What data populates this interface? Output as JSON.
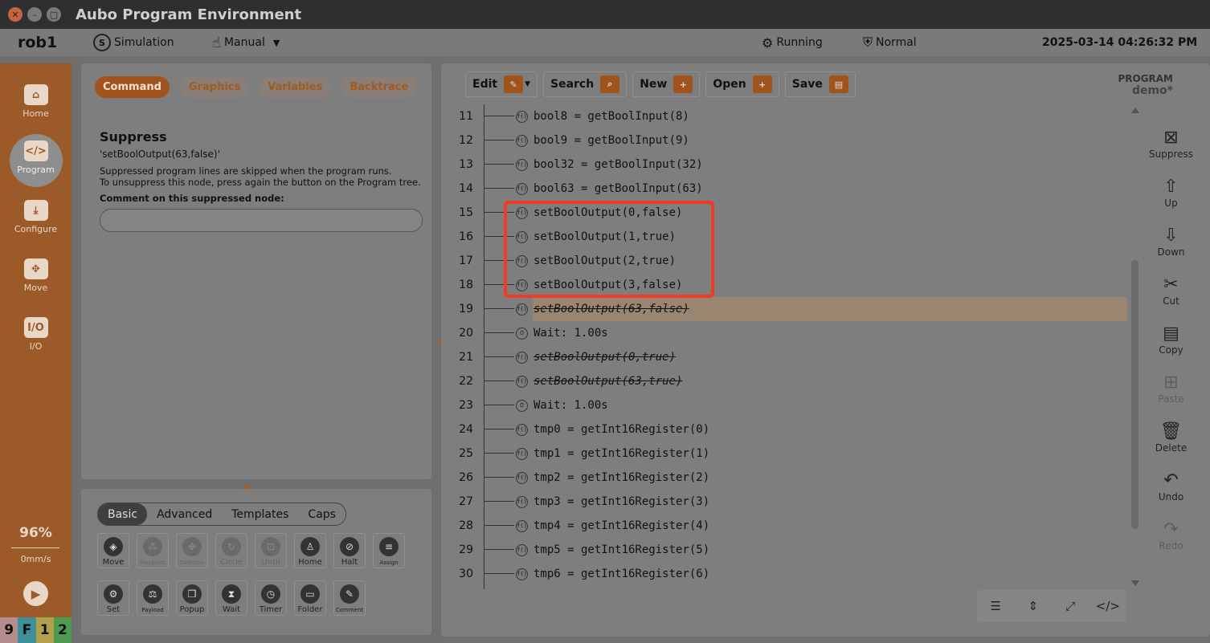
{
  "window": {
    "title": "Aubo Program Environment"
  },
  "header": {
    "robot": "rob1",
    "mode": "Simulation",
    "control": "Manual",
    "state": "Running",
    "safety": "Normal",
    "datetime": "2025-03-14 04:26:32 PM"
  },
  "nav": {
    "items": [
      {
        "label": "Home",
        "icon": "home-icon"
      },
      {
        "label": "Program",
        "icon": "code-icon"
      },
      {
        "label": "Configure",
        "icon": "download-icon"
      },
      {
        "label": "Move",
        "icon": "move-icon"
      },
      {
        "label": "I/O",
        "icon": "io-icon"
      }
    ],
    "speed_percent": "96%",
    "speed_value": "0mm/s",
    "fkeys": [
      {
        "label": "9",
        "color": "#b48c8c"
      },
      {
        "label": "F",
        "color": "#3f8f9a"
      },
      {
        "label": "1",
        "color": "#b2a04a"
      },
      {
        "label": "2",
        "color": "#4e9a4e"
      }
    ]
  },
  "left_tabs": [
    "Command",
    "Graphics",
    "Variables",
    "Backtrace"
  ],
  "suppress": {
    "title": "Suppress",
    "node": "'setBoolOutput(63,false)'",
    "desc1": "Suppressed program lines are skipped when the program runs.",
    "desc2": "To unsuppress this node, press again the button on the Program tree.",
    "comment_label": "Comment on this suppressed node:",
    "comment_value": ""
  },
  "palette": {
    "tabs": [
      "Basic",
      "Advanced",
      "Templates",
      "Caps"
    ],
    "buttons_row1": [
      "Move",
      "Waypoint",
      "Direction",
      "Circle",
      "Until",
      "Home",
      "Halt",
      "Assign"
    ],
    "buttons_row2": [
      "Set",
      "Payload",
      "Popup",
      "Wait",
      "Timer",
      "Folder",
      "Comment"
    ]
  },
  "toolbar": {
    "edit": "Edit",
    "search": "Search",
    "new": "New",
    "open": "Open",
    "save": "Save"
  },
  "program": {
    "label": "PROGRAM",
    "name": "demo*"
  },
  "code_lines": [
    {
      "n": "11",
      "text": "bool8 = getBoolInput(8)",
      "icon": "fn"
    },
    {
      "n": "12",
      "text": "bool9 = getBoolInput(9)",
      "icon": "fn"
    },
    {
      "n": "13",
      "text": "bool32 = getBoolInput(32)",
      "icon": "fn"
    },
    {
      "n": "14",
      "text": "bool63 = getBoolInput(63)",
      "icon": "fn"
    },
    {
      "n": "15",
      "text": "setBoolOutput(0,false)",
      "icon": "fn"
    },
    {
      "n": "16",
      "text": "setBoolOutput(1,true)",
      "icon": "fn"
    },
    {
      "n": "17",
      "text": "setBoolOutput(2,true)",
      "icon": "fn"
    },
    {
      "n": "18",
      "text": "setBoolOutput(3,false)",
      "icon": "fn"
    },
    {
      "n": "19",
      "text": "setBoolOutput(63,false)",
      "icon": "fn",
      "suppressed": true,
      "selected": true
    },
    {
      "n": "20",
      "text": "Wait: 1.00s",
      "icon": "wait"
    },
    {
      "n": "21",
      "text": "setBoolOutput(0,true)",
      "icon": "fn",
      "suppressed": true
    },
    {
      "n": "22",
      "text": "setBoolOutput(63,true)",
      "icon": "fn",
      "suppressed": true
    },
    {
      "n": "23",
      "text": "Wait: 1.00s",
      "icon": "wait"
    },
    {
      "n": "24",
      "text": "tmp0 = getInt16Register(0)",
      "icon": "fn"
    },
    {
      "n": "25",
      "text": "tmp1 = getInt16Register(1)",
      "icon": "fn"
    },
    {
      "n": "26",
      "text": "tmp2 = getInt16Register(2)",
      "icon": "fn"
    },
    {
      "n": "27",
      "text": "tmp3 = getInt16Register(3)",
      "icon": "fn"
    },
    {
      "n": "28",
      "text": "tmp4 = getInt16Register(4)",
      "icon": "fn"
    },
    {
      "n": "29",
      "text": "tmp5 = getInt16Register(5)",
      "icon": "fn"
    },
    {
      "n": "30",
      "text": "tmp6 = getInt16Register(6)",
      "icon": "fn"
    }
  ],
  "side_actions": [
    {
      "label": "Suppress",
      "icon": "suppress-icon",
      "enabled": true
    },
    {
      "label": "Up",
      "icon": "arrow-up-icon",
      "enabled": true
    },
    {
      "label": "Down",
      "icon": "arrow-down-icon",
      "enabled": true
    },
    {
      "label": "Cut",
      "icon": "scissors-icon",
      "enabled": true
    },
    {
      "label": "Copy",
      "icon": "copy-icon",
      "enabled": true
    },
    {
      "label": "Paste",
      "icon": "paste-icon",
      "enabled": false
    },
    {
      "label": "Delete",
      "icon": "trash-icon",
      "enabled": true
    },
    {
      "label": "Undo",
      "icon": "undo-icon",
      "enabled": true
    },
    {
      "label": "Redo",
      "icon": "redo-icon",
      "enabled": false
    }
  ],
  "accent_color": "#a0541c",
  "highlight_color": "#f03a21"
}
